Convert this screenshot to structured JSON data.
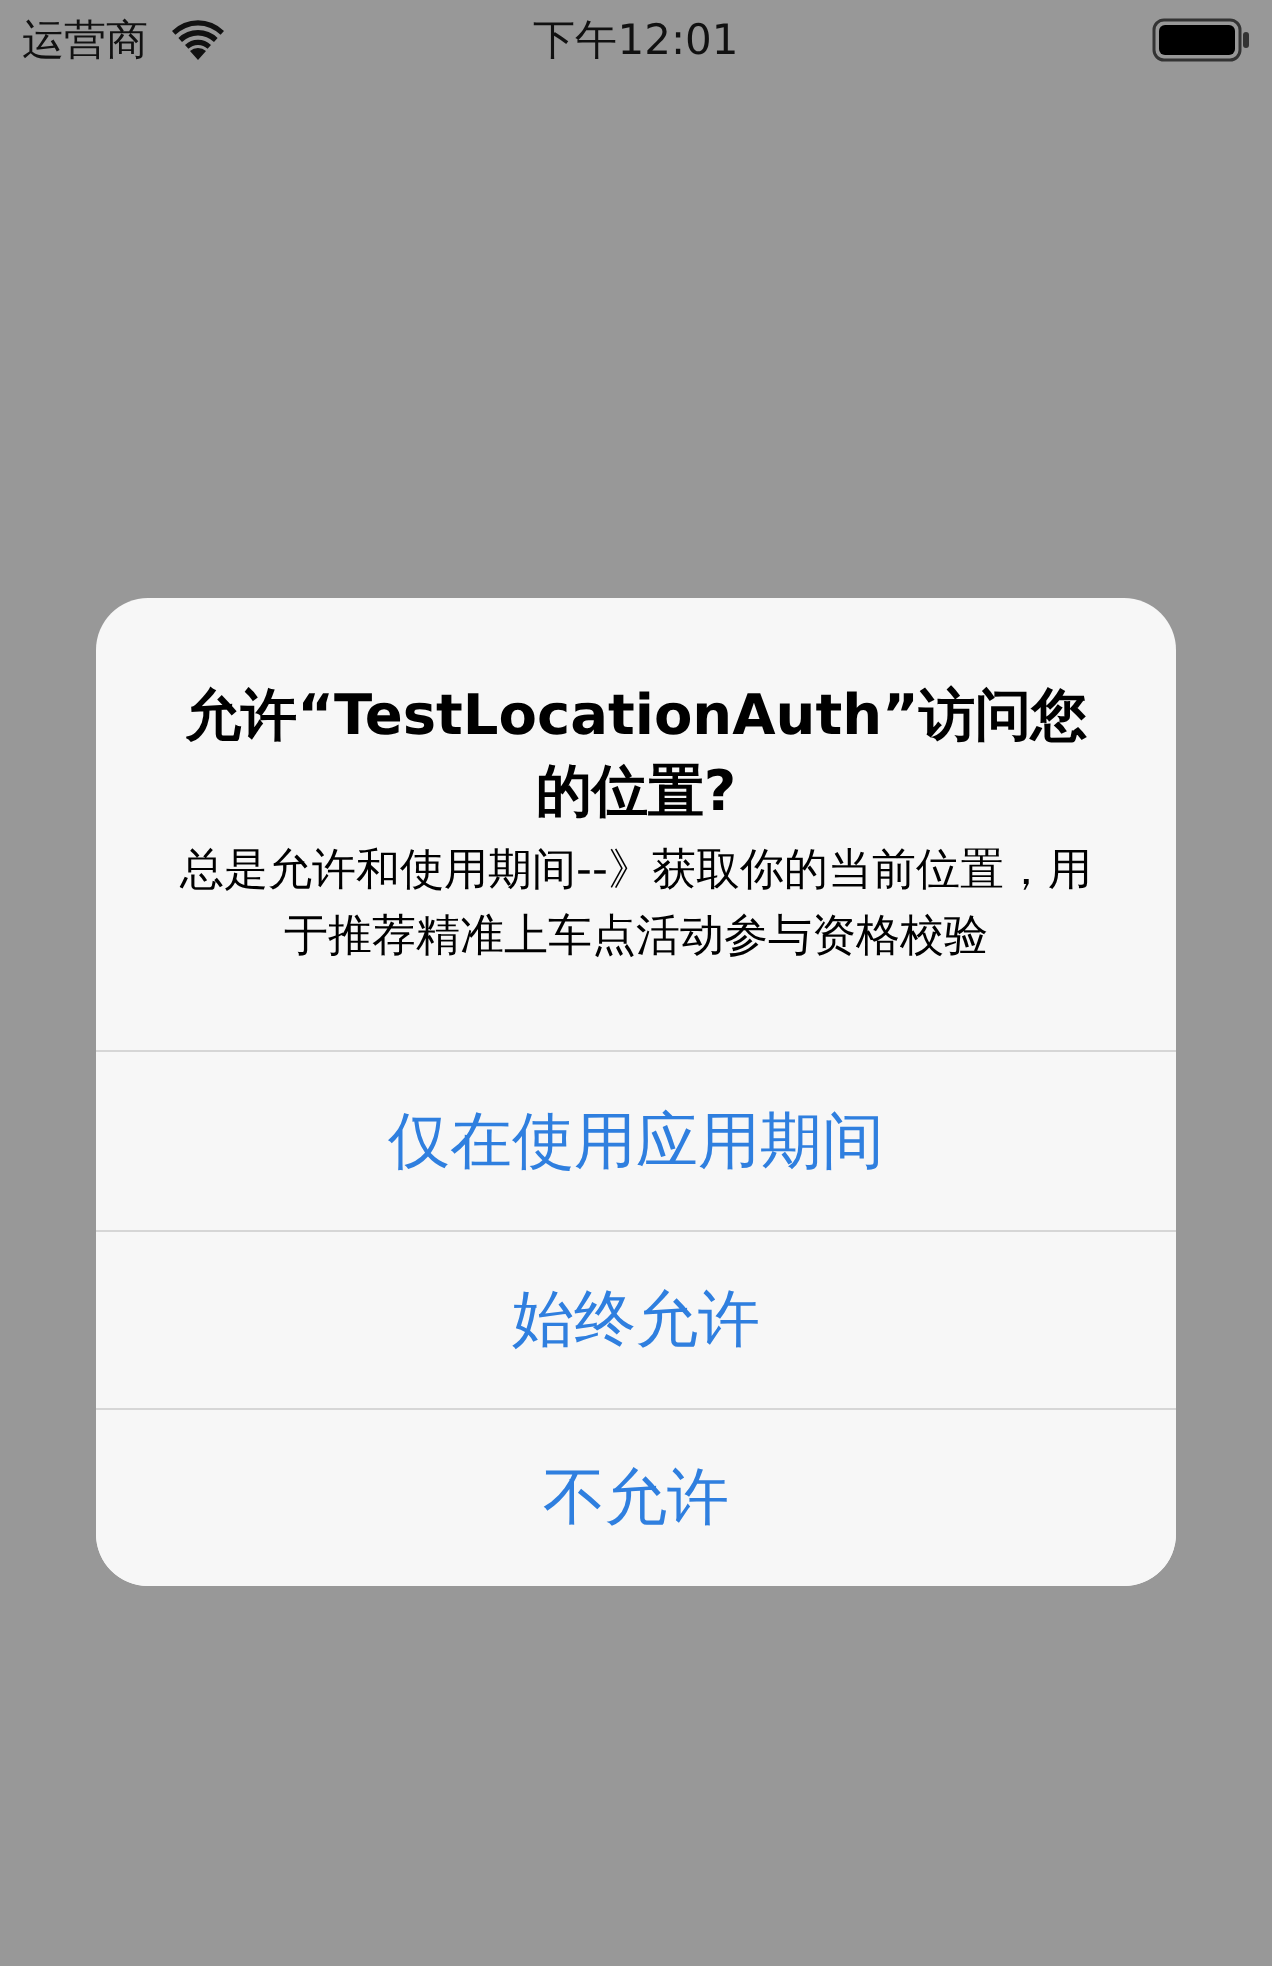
{
  "status_bar": {
    "carrier": "运营商",
    "time": "下午12:01"
  },
  "alert": {
    "title": "允许“TestLocationAuth”访问您的位置?",
    "message": "总是允许和使用期间--》获取你的当前位置，用于推荐精准上车点活动参与资格校验",
    "actions": [
      {
        "label": "仅在使用应用期间"
      },
      {
        "label": "始终允许"
      },
      {
        "label": "不允许"
      }
    ]
  }
}
